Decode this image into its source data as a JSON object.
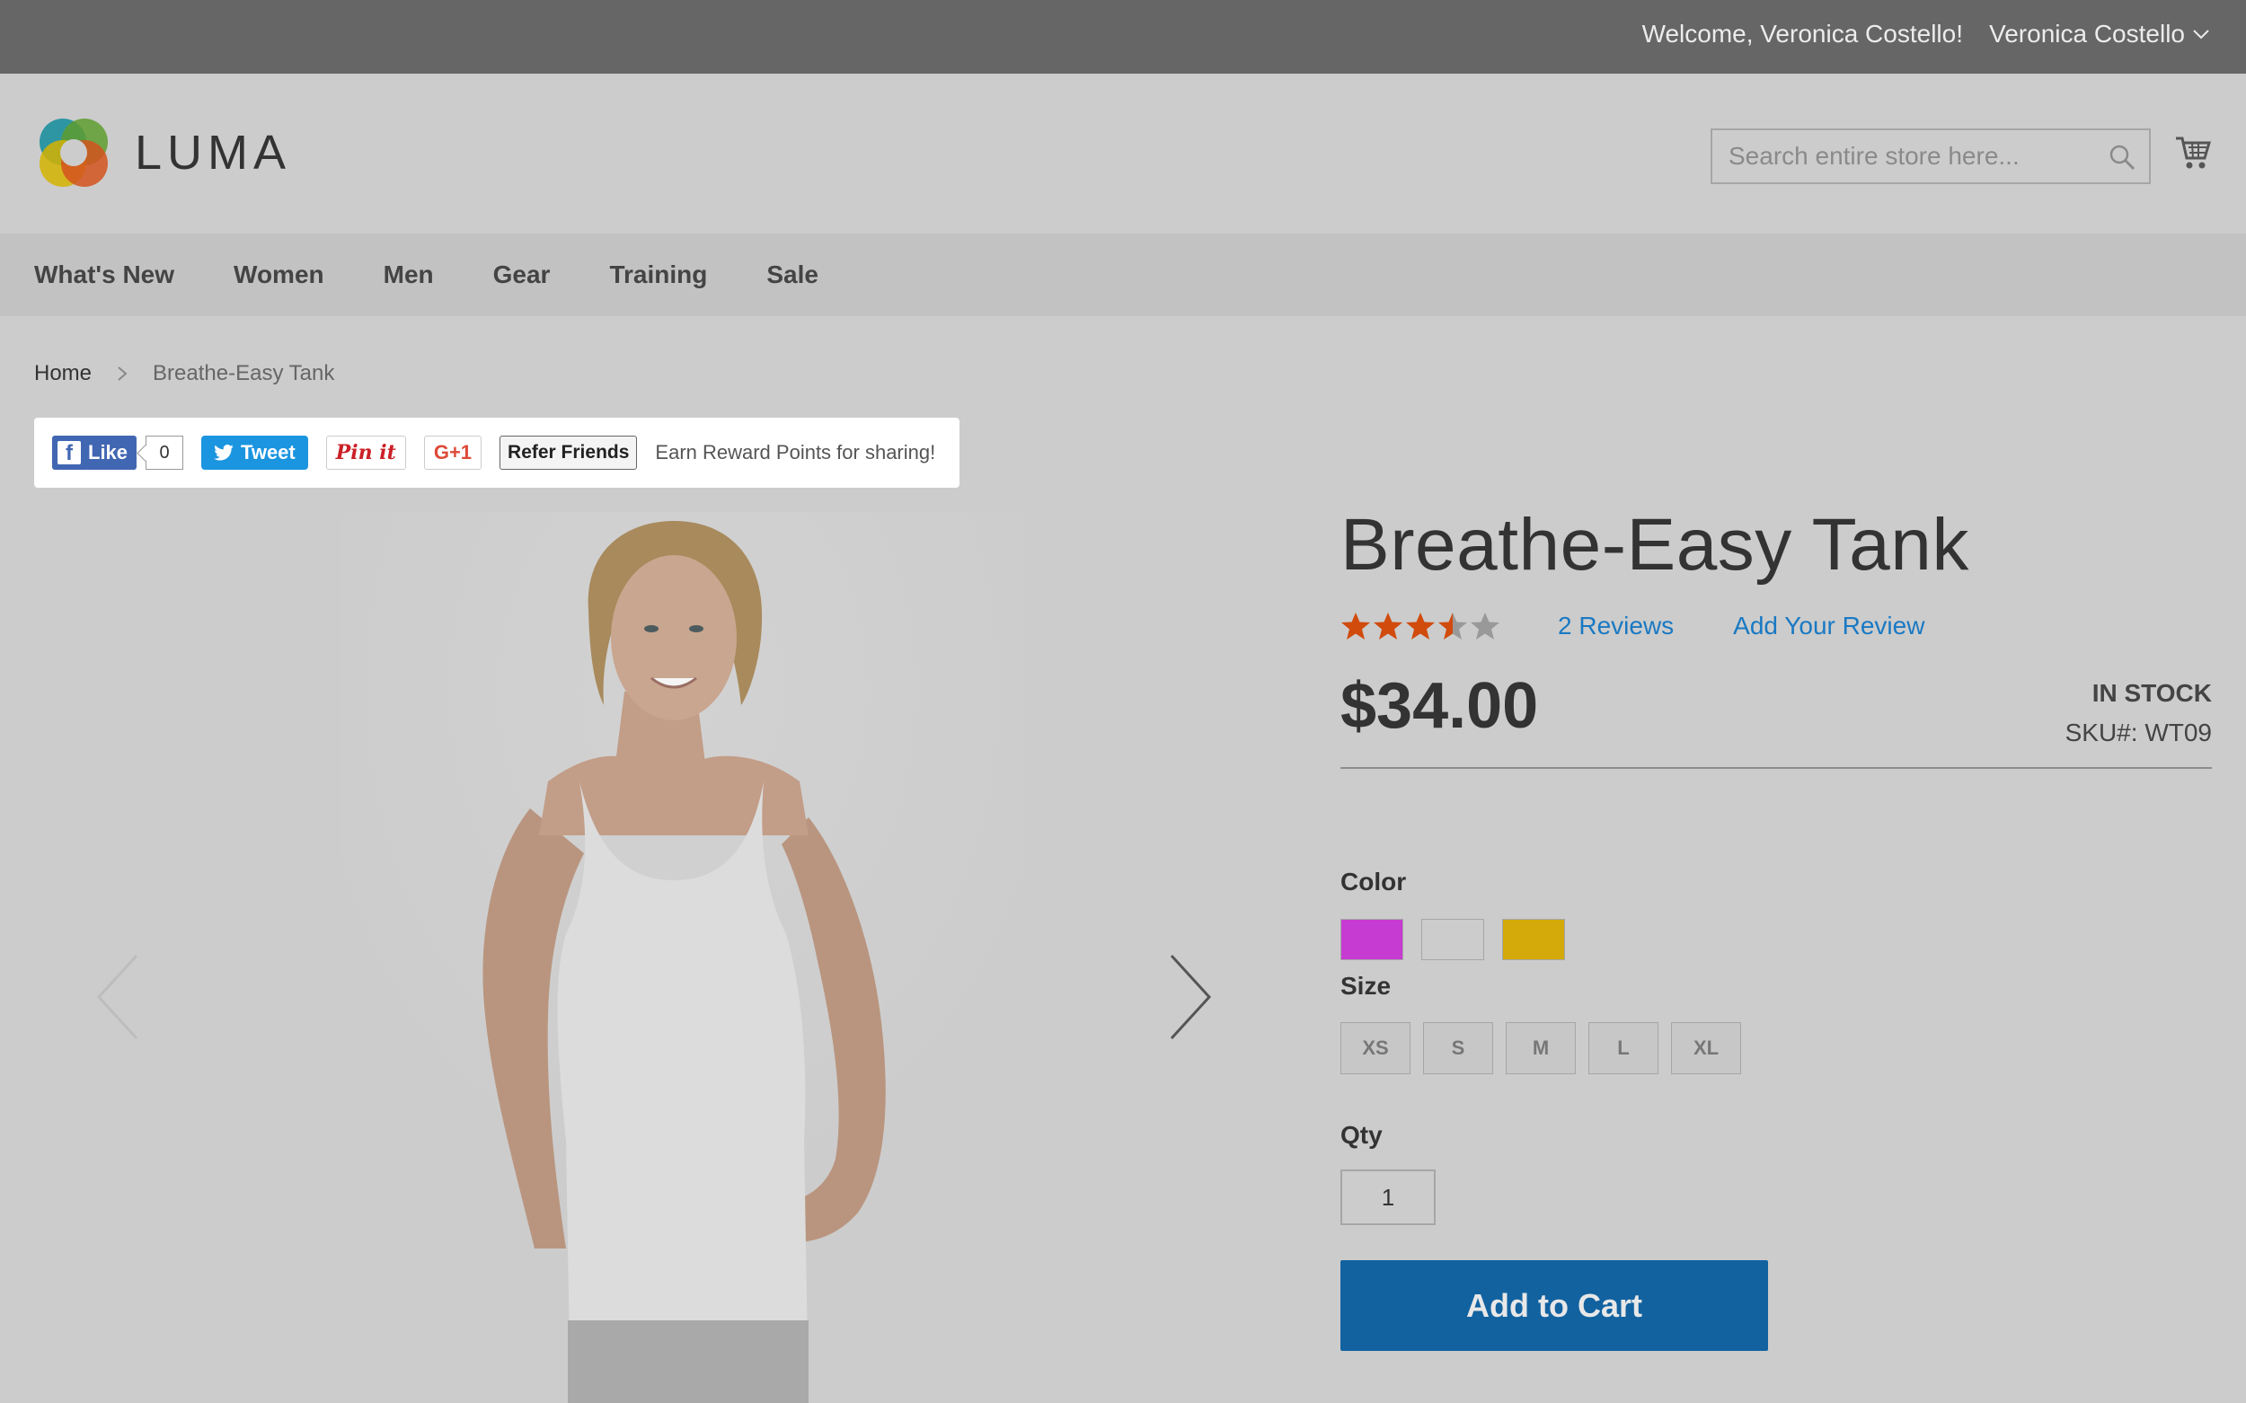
{
  "topbar": {
    "welcome": "Welcome, Veronica Costello!",
    "account_name": "Veronica Costello"
  },
  "header": {
    "logo_text": "LUMA",
    "search_placeholder": "Search entire store here..."
  },
  "nav": {
    "items": [
      "What's New",
      "Women",
      "Men",
      "Gear",
      "Training",
      "Sale"
    ]
  },
  "breadcrumb": {
    "home": "Home",
    "current": "Breathe-Easy Tank"
  },
  "share": {
    "like": "Like",
    "like_count": "0",
    "tweet": "Tweet",
    "pin": "Pin it",
    "gplus": "G+1",
    "refer": "Refer Friends",
    "earn_text": "Earn Reward Points for sharing!"
  },
  "product": {
    "title": "Breathe-Easy Tank",
    "rating_stars": 3.5,
    "rating_max": 5,
    "reviews_link": "2 Reviews",
    "add_review": "Add Your Review",
    "price": "$34.00",
    "stock": "IN STOCK",
    "sku": "SKU#:  WT09",
    "color_label": "Color",
    "colors": [
      "#c63bd1",
      "#cccccc",
      "#d4aa0a"
    ],
    "size_label": "Size",
    "sizes": [
      "XS",
      "S",
      "M",
      "L",
      "XL"
    ],
    "qty_label": "Qty",
    "qty_value": "1",
    "add_to_cart": "Add to Cart"
  },
  "colors": {
    "topbar_bg": "#666666",
    "page_bg": "#cccccc",
    "nav_bg": "#c2c2c2",
    "link": "#1979c3",
    "primary_button": "#1262a0",
    "star_filled": "#d14b0c",
    "star_empty": "#999999"
  }
}
